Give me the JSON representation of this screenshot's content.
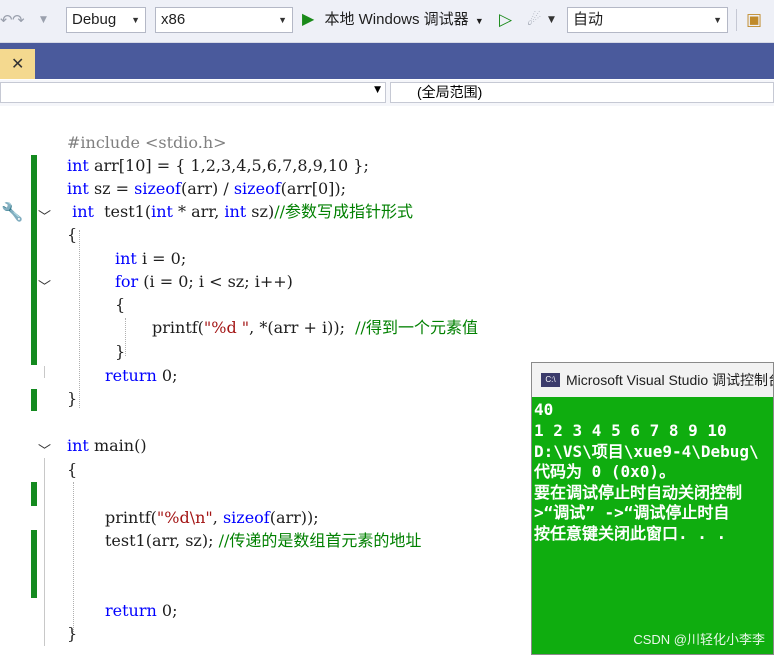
{
  "toolbar": {
    "config": "Debug",
    "platform": "x86",
    "run_label": "本地 Windows 调试器",
    "mode": "自动"
  },
  "nav": {
    "scope": "(全局范围)"
  },
  "code": {
    "l1": "#include <stdio.h>",
    "l2a": "int",
    "l2b": " arr[10] = { 1,2,3,4,5,6,7,8,9,10 };",
    "l3a": "int",
    "l3b": " sz = ",
    "l3c": "sizeof",
    "l3d": "(arr) / ",
    "l3e": "sizeof",
    "l3f": "(arr[0]);",
    "l4a": " int",
    "l4b": "  test1(",
    "l4c": "int",
    "l4d": " * arr, ",
    "l4e": "int",
    "l4f": " sz)",
    "l4g": "//参数写成指针形式",
    "l5": "{",
    "l6a": "int",
    "l6b": " i = 0;",
    "l7a": "for",
    "l7b": " (i = 0; i < sz; i++)",
    "l8": "{",
    "l9a": "printf(",
    "l9b": "\"%d \"",
    "l9c": ", *(arr + i));  ",
    "l9d": "//得到一个元素值",
    "l10": "}",
    "l11a": "return",
    "l11b": " 0;",
    "l12": "}",
    "l13a": "int",
    "l13b": " main()",
    "l14": "{",
    "l15a": "printf(",
    "l15b": "\"%d\\n\"",
    "l15c": ", ",
    "l15d": "sizeof",
    "l15e": "(arr));",
    "l16a": "test1(arr, sz); ",
    "l16b": "//传递的是数组首元素的地址",
    "l17a": "return",
    "l17b": " 0;",
    "l18": "}"
  },
  "console": {
    "title": "Microsoft Visual Studio 调试控制台",
    "lines": [
      "40",
      "1 2 3 4 5 6 7 8 9 10",
      "D:\\VS\\项目\\xue9-4\\Debug\\",
      "代码为 0 (0x0)。",
      "要在调试停止时自动关闭控制",
      ">“调试” ->“调试停止时自",
      "按任意键关闭此窗口. . ."
    ]
  },
  "watermark": "CSDN @川轻化小李李"
}
